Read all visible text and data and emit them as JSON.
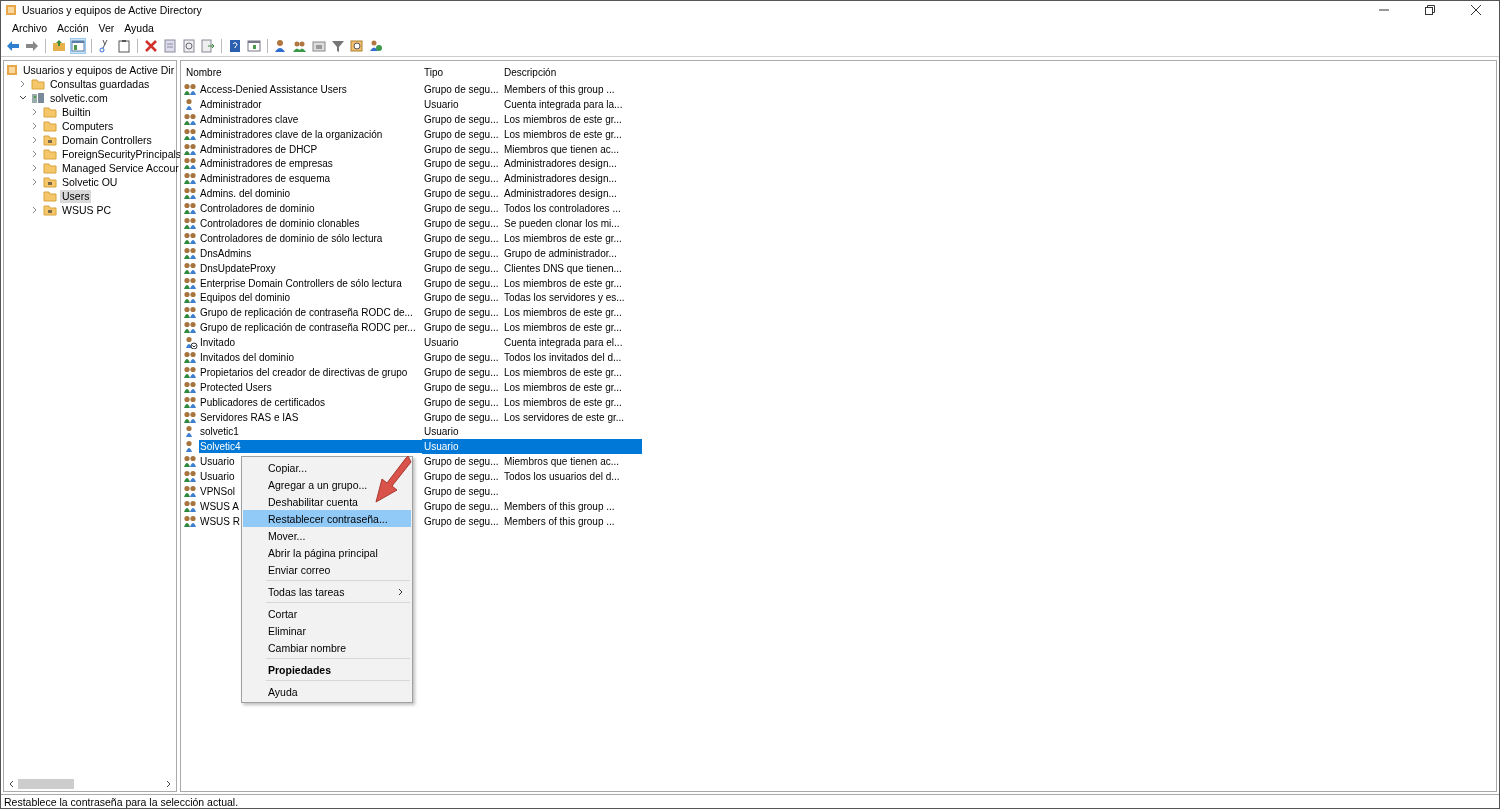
{
  "window": {
    "title": "Usuarios y equipos de Active Directory"
  },
  "menu_bar": [
    "Archivo",
    "Acción",
    "Ver",
    "Ayuda"
  ],
  "toolbar": [
    {
      "pressed": false
    },
    {
      "pressed": false
    },
    {
      "pressed": false
    },
    {
      "pressed": true
    },
    {
      "pressed": false
    },
    {
      "pressed": false
    },
    {
      "pressed": false
    },
    {
      "pressed": false
    },
    {
      "pressed": false
    },
    {
      "pressed": false
    },
    {
      "pressed": false
    },
    {
      "pressed": false
    },
    {
      "pressed": false
    },
    {
      "pressed": false
    },
    {
      "pressed": false
    },
    {
      "pressed": false
    },
    {
      "pressed": false
    },
    {
      "pressed": false
    }
  ],
  "tree": [
    {
      "label": "Usuarios y equipos de Active Dir",
      "kind": "root",
      "selected": false,
      "children": [
        {
          "label": "Consultas guardadas",
          "kind": "folder",
          "selected": false,
          "expanded": false
        },
        {
          "label": "solvetic.com",
          "kind": "domain",
          "selected": false,
          "expanded": true,
          "children": [
            {
              "label": "Builtin",
              "kind": "folder",
              "selected": false,
              "expanded": false
            },
            {
              "label": "Computers",
              "kind": "folder",
              "selected": false,
              "expanded": false
            },
            {
              "label": "Domain Controllers",
              "kind": "ou",
              "selected": false,
              "expanded": false
            },
            {
              "label": "ForeignSecurityPrincipals",
              "kind": "folder",
              "selected": false,
              "expanded": false
            },
            {
              "label": "Managed Service Accour",
              "kind": "folder",
              "selected": false,
              "expanded": false
            },
            {
              "label": "Solvetic OU",
              "kind": "ou",
              "selected": false,
              "expanded": false
            },
            {
              "label": "Users",
              "kind": "folder",
              "selected": true,
              "leaf": true
            },
            {
              "label": "WSUS PC",
              "kind": "ou",
              "selected": false,
              "expanded": false
            }
          ]
        }
      ]
    }
  ],
  "table": {
    "columns": [
      "Nombre",
      "Tipo",
      "Descripción"
    ],
    "rows": [
      {
        "kind": "group",
        "disabled": false,
        "selected": false,
        "cells": [
          "Access-Denied Assistance Users",
          "Grupo de segu...",
          "Members of this group ..."
        ]
      },
      {
        "kind": "user",
        "disabled": false,
        "selected": false,
        "cells": [
          "Administrador",
          "Usuario",
          "Cuenta integrada para la..."
        ]
      },
      {
        "kind": "group",
        "disabled": false,
        "selected": false,
        "cells": [
          "Administradores clave",
          "Grupo de segu...",
          "Los miembros de este gr..."
        ]
      },
      {
        "kind": "group",
        "disabled": false,
        "selected": false,
        "cells": [
          "Administradores clave de la organización",
          "Grupo de segu...",
          "Los miembros de este gr..."
        ]
      },
      {
        "kind": "group",
        "disabled": false,
        "selected": false,
        "cells": [
          "Administradores de DHCP",
          "Grupo de segu...",
          "Miembros que tienen ac..."
        ]
      },
      {
        "kind": "group",
        "disabled": false,
        "selected": false,
        "cells": [
          "Administradores de empresas",
          "Grupo de segu...",
          "Administradores design..."
        ]
      },
      {
        "kind": "group",
        "disabled": false,
        "selected": false,
        "cells": [
          "Administradores de esquema",
          "Grupo de segu...",
          "Administradores design..."
        ]
      },
      {
        "kind": "group",
        "disabled": false,
        "selected": false,
        "cells": [
          "Admins. del dominio",
          "Grupo de segu...",
          "Administradores design..."
        ]
      },
      {
        "kind": "group",
        "disabled": false,
        "selected": false,
        "cells": [
          "Controladores de dominio",
          "Grupo de segu...",
          "Todos los controladores ..."
        ]
      },
      {
        "kind": "group",
        "disabled": false,
        "selected": false,
        "cells": [
          "Controladores de dominio clonables",
          "Grupo de segu...",
          "Se pueden clonar los mi..."
        ]
      },
      {
        "kind": "group",
        "disabled": false,
        "selected": false,
        "cells": [
          "Controladores de dominio de sólo lectura",
          "Grupo de segu...",
          "Los miembros de este gr..."
        ]
      },
      {
        "kind": "group",
        "disabled": false,
        "selected": false,
        "cells": [
          "DnsAdmins",
          "Grupo de segu...",
          "Grupo de administrador..."
        ]
      },
      {
        "kind": "group",
        "disabled": false,
        "selected": false,
        "cells": [
          "DnsUpdateProxy",
          "Grupo de segu...",
          "Clientes DNS que tienen..."
        ]
      },
      {
        "kind": "group",
        "disabled": false,
        "selected": false,
        "cells": [
          "Enterprise Domain Controllers de sólo lectura",
          "Grupo de segu...",
          "Los miembros de este gr..."
        ]
      },
      {
        "kind": "group",
        "disabled": false,
        "selected": false,
        "cells": [
          "Equipos del dominio",
          "Grupo de segu...",
          "Todas los servidores y es..."
        ]
      },
      {
        "kind": "group",
        "disabled": false,
        "selected": false,
        "cells": [
          "Grupo de replicación de contraseña RODC de...",
          "Grupo de segu...",
          "Los miembros de este gr..."
        ]
      },
      {
        "kind": "group",
        "disabled": false,
        "selected": false,
        "cells": [
          "Grupo de replicación de contraseña RODC per...",
          "Grupo de segu...",
          "Los miembros de este gr..."
        ]
      },
      {
        "kind": "user",
        "disabled": true,
        "selected": false,
        "cells": [
          "Invitado",
          "Usuario",
          "Cuenta integrada para el..."
        ]
      },
      {
        "kind": "group",
        "disabled": false,
        "selected": false,
        "cells": [
          "Invitados del dominio",
          "Grupo de segu...",
          "Todos los invitados del d..."
        ]
      },
      {
        "kind": "group",
        "disabled": false,
        "selected": false,
        "cells": [
          "Propietarios del creador de directivas de grupo",
          "Grupo de segu...",
          "Los miembros de este gr..."
        ]
      },
      {
        "kind": "group",
        "disabled": false,
        "selected": false,
        "cells": [
          "Protected Users",
          "Grupo de segu...",
          "Los miembros de este gr..."
        ]
      },
      {
        "kind": "group",
        "disabled": false,
        "selected": false,
        "cells": [
          "Publicadores de certificados",
          "Grupo de segu...",
          "Los miembros de este gr..."
        ]
      },
      {
        "kind": "group",
        "disabled": false,
        "selected": false,
        "cells": [
          "Servidores RAS e IAS",
          "Grupo de segu...",
          "Los servidores de este gr..."
        ]
      },
      {
        "kind": "user",
        "disabled": false,
        "selected": false,
        "cells": [
          "solvetic1",
          "Usuario",
          ""
        ]
      },
      {
        "kind": "user",
        "disabled": false,
        "selected": true,
        "cells": [
          "Solvetic4",
          "Usuario",
          ""
        ]
      },
      {
        "kind": "group",
        "disabled": false,
        "selected": false,
        "cells": [
          "Usuario",
          "Grupo de segu...",
          "Miembros que tienen ac..."
        ]
      },
      {
        "kind": "group",
        "disabled": false,
        "selected": false,
        "cells": [
          "Usuario",
          "Grupo de segu...",
          "Todos los usuarios del d..."
        ]
      },
      {
        "kind": "group",
        "disabled": false,
        "selected": false,
        "cells": [
          "VPNSol",
          "Grupo de segu...",
          ""
        ]
      },
      {
        "kind": "group",
        "disabled": false,
        "selected": false,
        "cells": [
          "WSUS A",
          "Grupo de segu...",
          "Members of this group ..."
        ]
      },
      {
        "kind": "group",
        "disabled": false,
        "selected": false,
        "cells": [
          "WSUS R",
          "Grupo de segu...",
          "Members of this group ..."
        ]
      }
    ]
  },
  "context_menu": {
    "items": [
      {
        "kind": "item",
        "label": "Copiar...",
        "selected": false,
        "default": false,
        "submenu": false
      },
      {
        "kind": "item",
        "label": "Agregar a un grupo...",
        "selected": false,
        "default": false,
        "submenu": false
      },
      {
        "kind": "item",
        "label": "Deshabilitar cuenta",
        "selected": false,
        "default": false,
        "submenu": false
      },
      {
        "kind": "item",
        "label": "Restablecer contraseña...",
        "selected": true,
        "default": false,
        "submenu": false
      },
      {
        "kind": "item",
        "label": "Mover...",
        "selected": false,
        "default": false,
        "submenu": false
      },
      {
        "kind": "item",
        "label": "Abrir la página principal",
        "selected": false,
        "default": false,
        "submenu": false
      },
      {
        "kind": "item",
        "label": "Enviar correo",
        "selected": false,
        "default": false,
        "submenu": false
      },
      {
        "kind": "separator"
      },
      {
        "kind": "item",
        "label": "Todas las tareas",
        "selected": false,
        "default": false,
        "submenu": true
      },
      {
        "kind": "separator"
      },
      {
        "kind": "item",
        "label": "Cortar",
        "selected": false,
        "default": false,
        "submenu": false
      },
      {
        "kind": "item",
        "label": "Eliminar",
        "selected": false,
        "default": false,
        "submenu": false
      },
      {
        "kind": "item",
        "label": "Cambiar nombre",
        "selected": false,
        "default": false,
        "submenu": false
      },
      {
        "kind": "separator"
      },
      {
        "kind": "item",
        "label": "Propiedades",
        "selected": false,
        "default": true,
        "submenu": false
      },
      {
        "kind": "separator"
      },
      {
        "kind": "item",
        "label": "Ayuda",
        "selected": false,
        "default": false,
        "submenu": false
      }
    ]
  },
  "status_bar": "Restablece la contraseña para la selección actual."
}
